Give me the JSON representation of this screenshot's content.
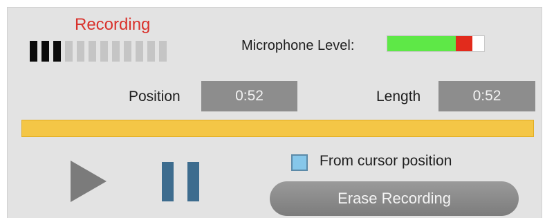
{
  "recorder": {
    "status_label": "Recording",
    "status_color": "#d9312b",
    "level_meter": {
      "segments": 12,
      "active": 3
    }
  },
  "microphone": {
    "label": "Microphone Level:",
    "level": {
      "green": 0.71,
      "red": 0.17
    }
  },
  "position": {
    "label": "Position",
    "value": "0:52"
  },
  "length": {
    "label": "Length",
    "value": "0:52"
  },
  "progress": {
    "fraction": 1.0,
    "color": "#f4c646"
  },
  "controls": {
    "play_icon": "play-icon",
    "pause_icon": "pause-icon",
    "from_cursor_label": "From cursor position",
    "from_cursor_checked": false,
    "erase_label": "Erase Recording"
  }
}
